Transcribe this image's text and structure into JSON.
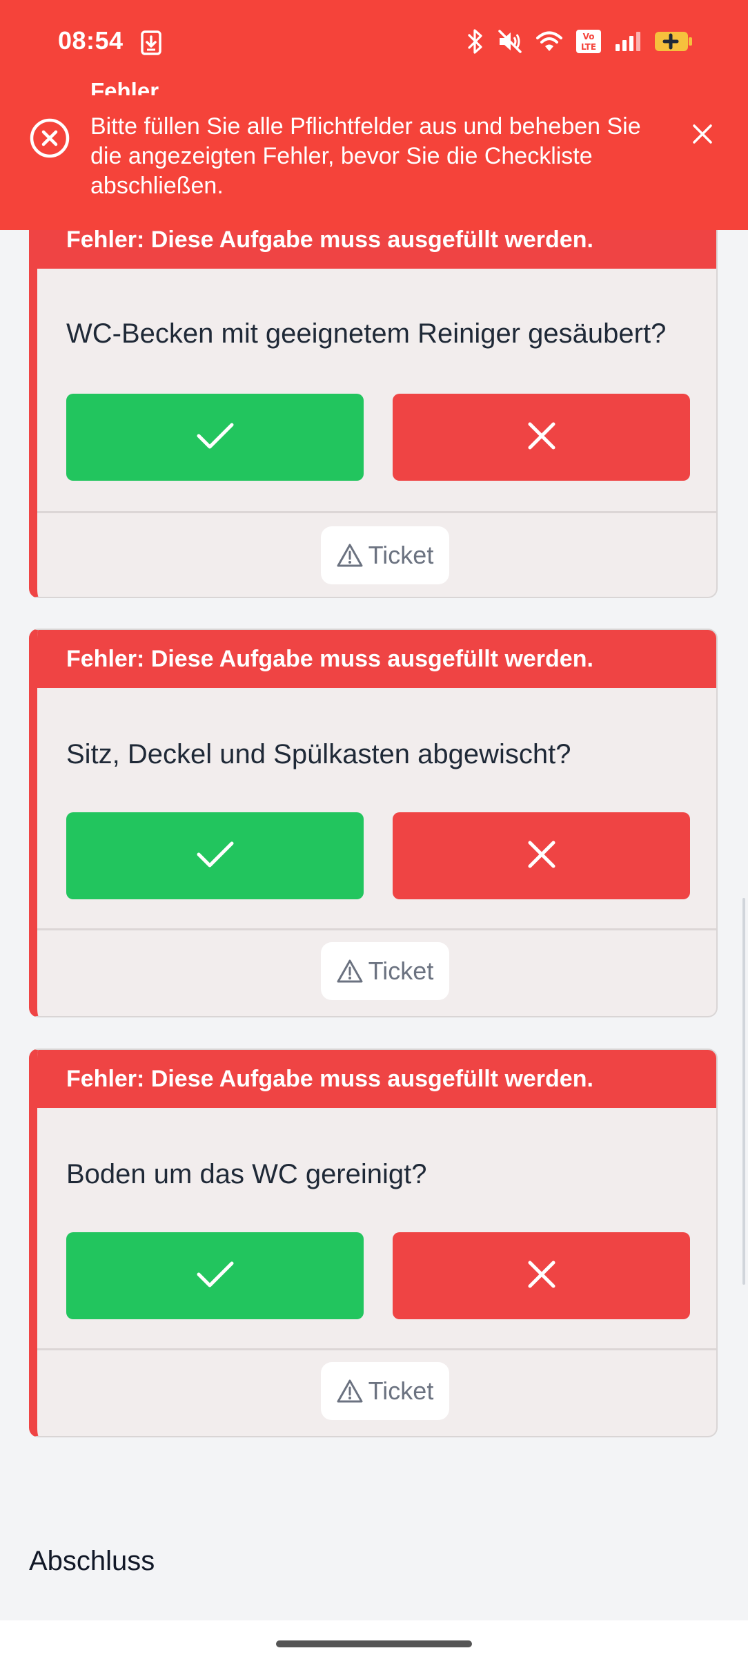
{
  "status_bar": {
    "time": "08:54",
    "icons": [
      "download-icon",
      "bluetooth-icon",
      "mute-icon",
      "wifi-icon",
      "volte-icon",
      "signal-icon",
      "battery-icon"
    ],
    "volte_label": "Vo LTE"
  },
  "toast": {
    "title": "Fehler",
    "message": "Bitte füllen Sie alle Pflichtfelder aus und beheben Sie die angezeigten Fehler, bevor Sie die Checkliste abschließen.",
    "icon": "error-circle-icon",
    "close_icon": "close-icon",
    "color": "#f5433a"
  },
  "tasks": [
    {
      "error": "Fehler: Diese Aufgabe muss ausgefüllt werden.",
      "question": "WC-Becken mit geeignetem Reiniger gesäubert?",
      "ticket_label": "Ticket"
    },
    {
      "error": "Fehler: Diese Aufgabe muss ausgefüllt werden.",
      "question": "Sitz, Deckel und Spülkasten abgewischt?",
      "ticket_label": "Ticket"
    },
    {
      "error": "Fehler: Diese Aufgabe muss ausgefüllt werden.",
      "question": "Boden um das WC gereinigt?",
      "ticket_label": "Ticket"
    }
  ],
  "colors": {
    "yes": "#22c55e",
    "no": "#ef4444",
    "error_banner": "#ef4444"
  },
  "section": {
    "title": "Abschluss"
  }
}
